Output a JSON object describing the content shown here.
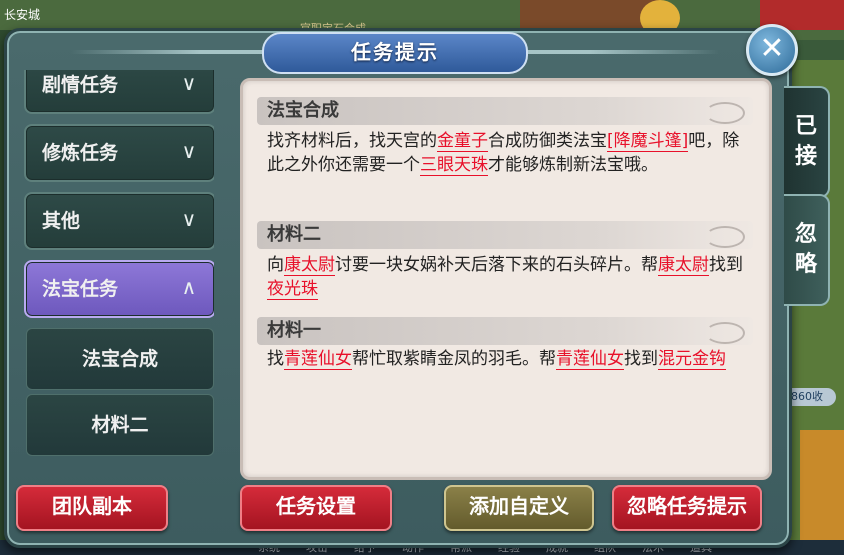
{
  "background": {
    "top_left_text": "长安城",
    "top_center_text": "官职宝石合成",
    "side_counter": "860收",
    "bottom_bar": [
      "系统",
      "攻击",
      "给予",
      "动作",
      "帮派",
      "经验",
      "成就",
      "组队",
      "法术",
      "道具"
    ]
  },
  "dialog": {
    "title": "任务提示",
    "close_label": "✕"
  },
  "left_list": {
    "categories": [
      {
        "label": "剧情任务",
        "state": "collapsed"
      },
      {
        "label": "修炼任务",
        "state": "collapsed"
      },
      {
        "label": "其他",
        "state": "collapsed"
      },
      {
        "label": "法宝任务",
        "state": "expanded"
      }
    ],
    "sub_items": [
      "法宝合成",
      "材料二"
    ]
  },
  "content": {
    "sections": [
      {
        "heading": "法宝合成",
        "segments": [
          {
            "t": "找齐材料后，找天宫的",
            "hl": false
          },
          {
            "t": "金童子",
            "hl": true
          },
          {
            "t": "合成防御类法宝",
            "hl": false
          },
          {
            "t": "[降魔斗篷]",
            "hl": true
          },
          {
            "t": "吧，除此之外你还需要一个",
            "hl": false
          },
          {
            "t": "三眼天珠",
            "hl": true
          },
          {
            "t": "才能够炼制新法宝哦。",
            "hl": false
          }
        ]
      },
      {
        "heading": "材料二",
        "segments": [
          {
            "t": "向",
            "hl": false
          },
          {
            "t": "康太尉",
            "hl": true
          },
          {
            "t": "讨要一块女娲补天后落下来的石头碎片。帮",
            "hl": false
          },
          {
            "t": "康太尉",
            "hl": true
          },
          {
            "t": "找到",
            "hl": false
          },
          {
            "t": "夜光珠",
            "hl": true
          }
        ]
      },
      {
        "heading": "材料一",
        "segments": [
          {
            "t": "找",
            "hl": false
          },
          {
            "t": "青莲仙女",
            "hl": true
          },
          {
            "t": "帮忙取紫睛金凤的羽毛。帮",
            "hl": false
          },
          {
            "t": "青莲仙女",
            "hl": true
          },
          {
            "t": "找到",
            "hl": false
          },
          {
            "t": "混元金钩",
            "hl": true
          }
        ]
      }
    ]
  },
  "tabs": {
    "accepted": "已接",
    "ignored": "忽略"
  },
  "buttons": {
    "team_dungeon": "团队副本",
    "task_settings": "任务设置",
    "add_custom": "添加自定义",
    "ignore_tips": "忽略任务提示"
  },
  "colors": {
    "highlight": "#e8102a",
    "active_category": "#7b66c9",
    "red_button": "#c21f2e",
    "olive_button": "#7a703c"
  }
}
